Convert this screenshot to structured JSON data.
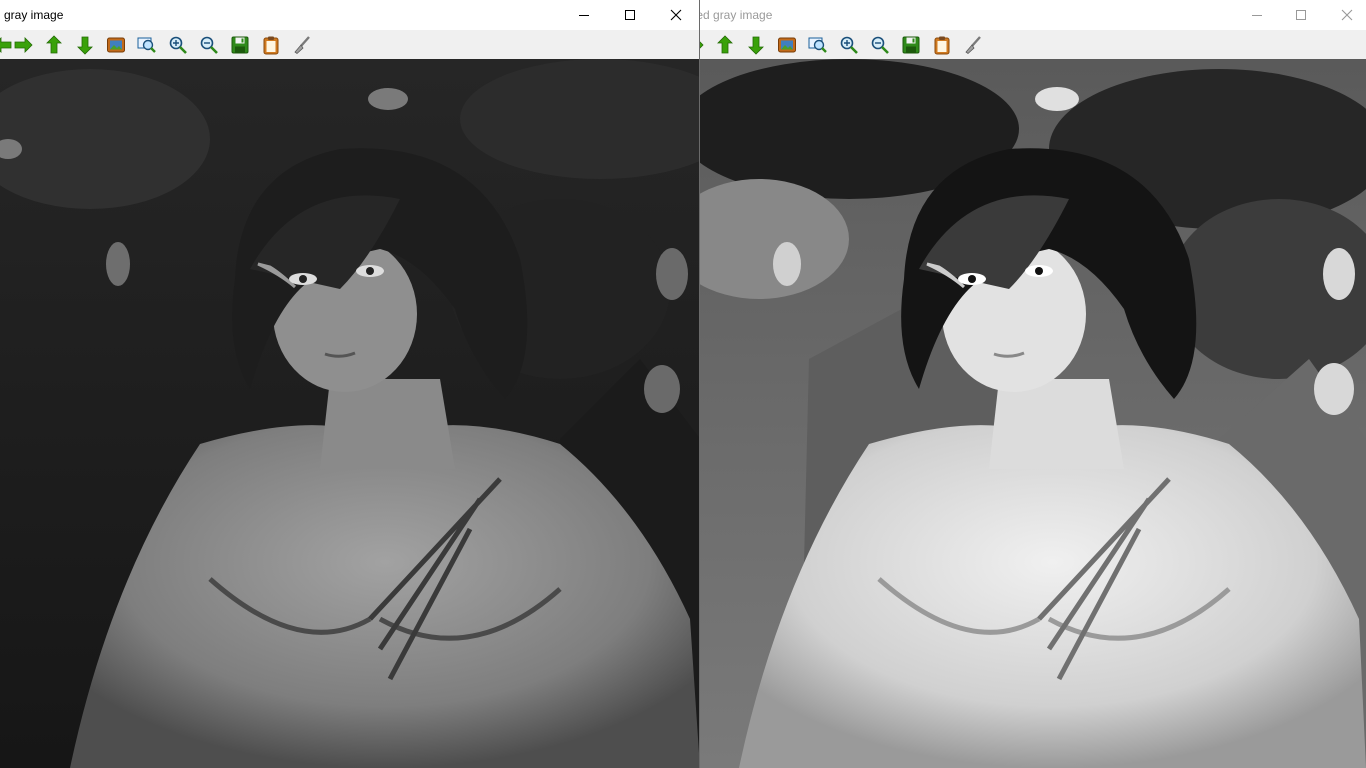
{
  "left_window": {
    "title": "gray image",
    "toolbar": [
      "arrow-right-icon",
      "arrow-up-icon",
      "arrow-down-icon",
      "image-icon",
      "zoom-to-fit-icon",
      "zoom-in-icon",
      "zoom-out-icon",
      "save-icon",
      "copy-icon",
      "brush-icon"
    ]
  },
  "right_window": {
    "title": "equalized gray image",
    "title_visible": "lized gray image",
    "toolbar": [
      "arrow-right-icon",
      "arrow-up-icon",
      "arrow-down-icon",
      "image-icon",
      "zoom-to-fit-icon",
      "zoom-in-icon",
      "zoom-out-icon",
      "save-icon",
      "copy-icon",
      "brush-icon"
    ]
  },
  "colors": {
    "toolbar_bg": "#f0f0f0",
    "arrow_green": "#3aa10a",
    "save_green": "#2f8a1a",
    "image_orange": "#c26a1a",
    "clipboard_orange": "#d07a20"
  }
}
